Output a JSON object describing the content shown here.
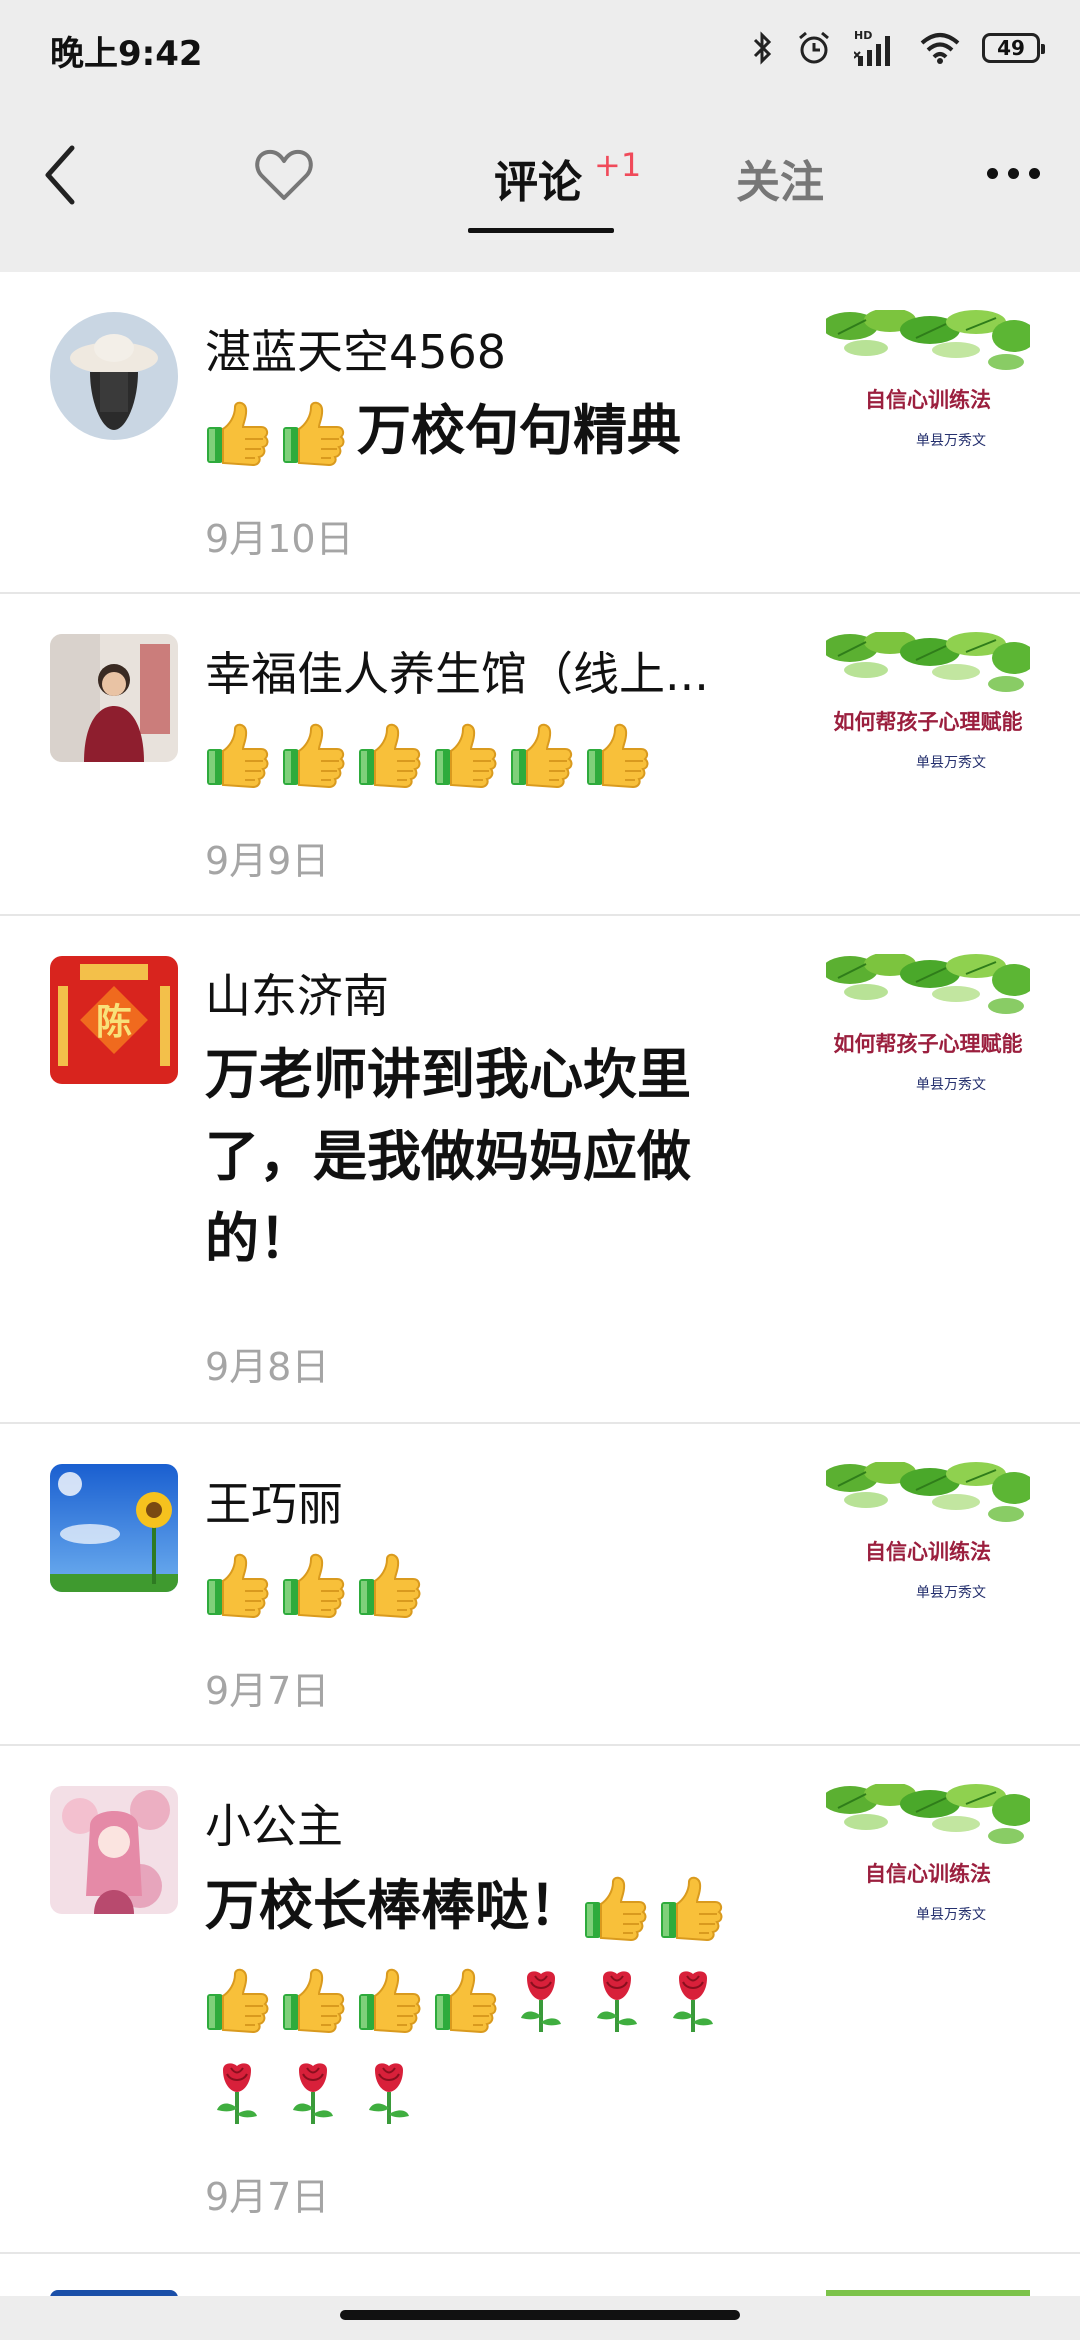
{
  "status": {
    "time": "晚上9:42",
    "battery": "49"
  },
  "nav": {
    "tab_comments": "评论",
    "tab_comments_badge": "+1",
    "tab_follow": "关注"
  },
  "comments": [
    {
      "name": "湛蓝天空4568",
      "text": "万校句句精典",
      "date": "9月10日",
      "thumb_title": "自信心训练法",
      "thumb_author": "单县万秀文"
    },
    {
      "name": "幸福佳人养生馆（线上...",
      "text": "",
      "date": "9月9日",
      "thumb_title": "如何帮孩子心理赋能",
      "thumb_author": "单县万秀文"
    },
    {
      "name": "山东济南",
      "text": "万老师讲到我心坎里了，是我做妈妈应做的！",
      "date": "9月8日",
      "thumb_title": "如何帮孩子心理赋能",
      "thumb_author": "单县万秀文"
    },
    {
      "name": "王巧丽",
      "text": "",
      "date": "9月7日",
      "thumb_title": "自信心训练法",
      "thumb_author": "单县万秀文"
    },
    {
      "name": "小公主",
      "text": "万校长棒棒哒！",
      "date": "9月7日",
      "thumb_title": "自信心训练法",
      "thumb_author": "单县万秀文"
    }
  ],
  "avatar3_char": "陈",
  "colors": {
    "badge": "#f04a5a",
    "date": "#a5a5a5",
    "thumb_title": "#9b1f3e"
  }
}
